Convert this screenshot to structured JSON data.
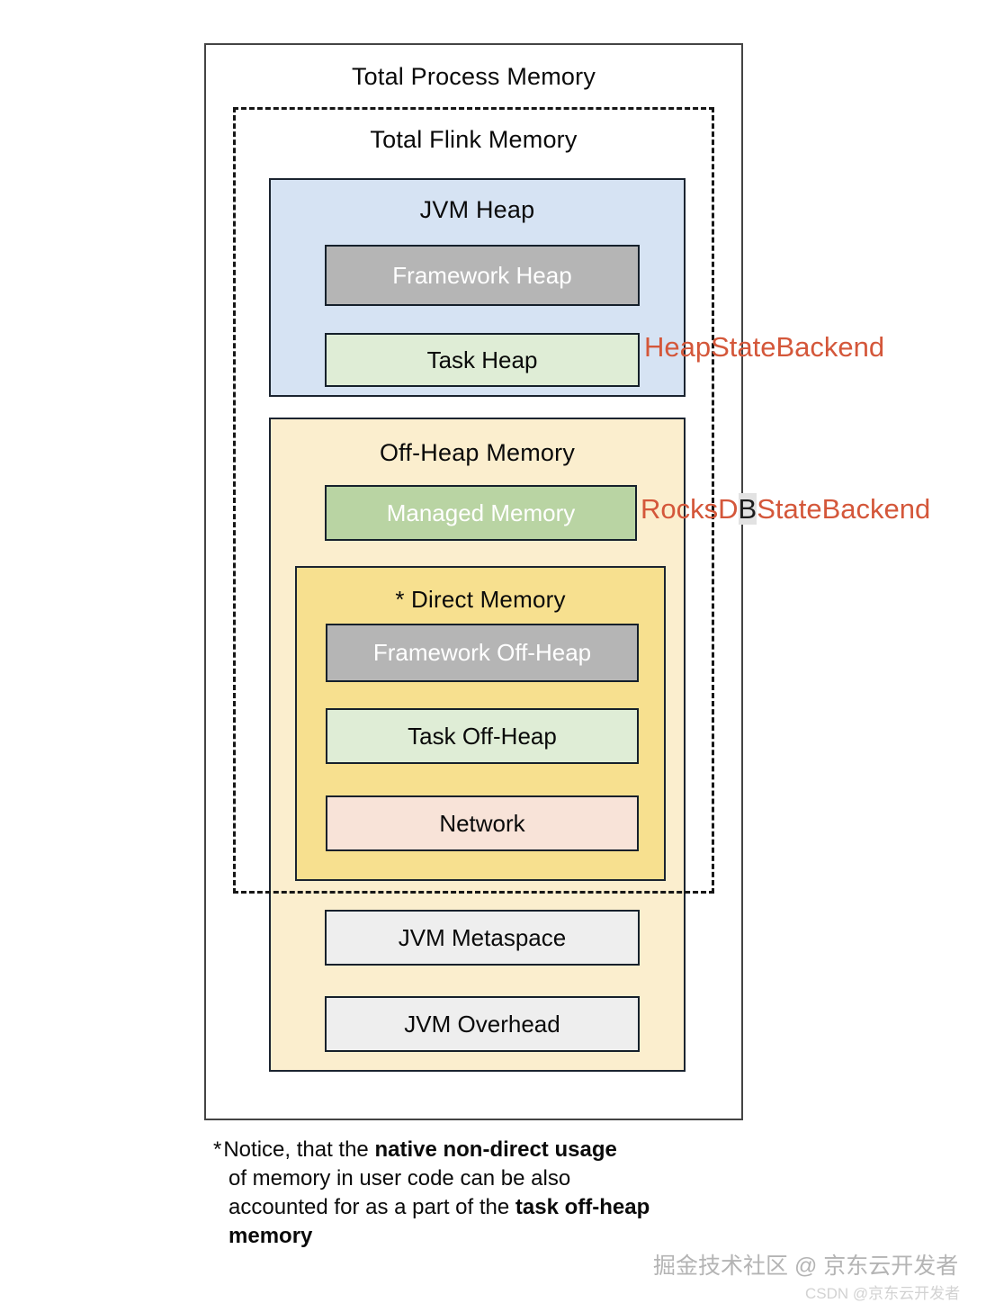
{
  "diagram": {
    "outer": {
      "title": "Total Process Memory"
    },
    "flink": {
      "title": "Total Flink Memory"
    },
    "jvm_heap": {
      "title": "JVM Heap",
      "framework_heap": "Framework Heap",
      "task_heap": "Task Heap"
    },
    "off_heap": {
      "title": "Off-Heap Memory",
      "managed_memory": "Managed Memory",
      "direct_memory": {
        "title": "* Direct Memory",
        "framework_off_heap": "Framework Off-Heap",
        "task_off_heap": "Task Off-Heap",
        "network": "Network"
      },
      "jvm_metaspace": "JVM Metaspace",
      "jvm_overhead": "JVM Overhead"
    },
    "annotations": {
      "heap_state_backend": "HeapStateBackend",
      "rocksdb_prefix": "RocksD",
      "rocksdb_highlight": "B",
      "rocksdb_suffix": "StateBackend"
    },
    "colors": {
      "jvm_heap_fill": "#d6e3f3",
      "off_heap_fill": "#fbeece",
      "direct_memory_fill": "#f7e08f",
      "framework_fill": "#b5b5b5",
      "task_heap_fill": "#dfedd6",
      "managed_memory_fill": "#b9d4a3",
      "network_fill": "#f8e3d8",
      "jvm_block_fill": "#eeeeee",
      "annotation_text": "#d4573a",
      "border": "#15202b"
    }
  },
  "footnote": {
    "star": "*",
    "line1_normal": "Notice, that the ",
    "line1_bold": "native non-direct usage",
    "line2": "of memory in user code can be also",
    "line3_normal": "accounted for as a part of the ",
    "line3_bold": "task off-heap",
    "line4_bold": "memory"
  },
  "watermarks": {
    "primary": "掘金技术社区 @ 京东云开发者",
    "csdn": "CSDN @京东云开发者"
  }
}
